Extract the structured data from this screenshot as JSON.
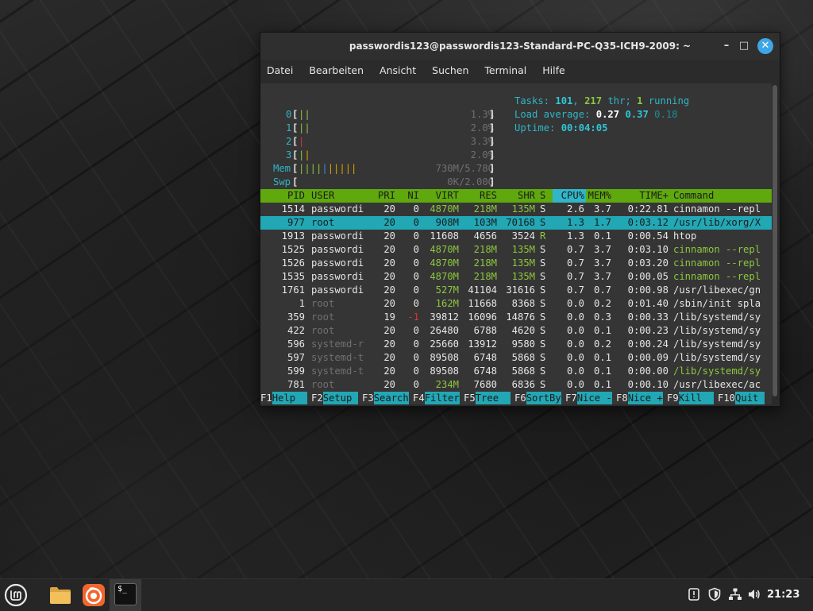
{
  "window": {
    "title": "passwordis123@passwordis123-Standard-PC-Q35-ICH9-2009: ~",
    "minimize": "–",
    "maximize": "□",
    "close": "✕"
  },
  "menu": [
    "Datei",
    "Bearbeiten",
    "Ansicht",
    "Suchen",
    "Terminal",
    "Hilfe"
  ],
  "meters": {
    "cpus": [
      {
        "label": "0",
        "value": "1.3%"
      },
      {
        "label": "1",
        "value": "2.0%"
      },
      {
        "label": "2",
        "value": "3.3%"
      },
      {
        "label": "3",
        "value": "2.0%"
      }
    ],
    "mem": {
      "label": "Mem",
      "value": "730M/5.78G"
    },
    "swp": {
      "label": "Swp",
      "value": "0K/2.00G"
    }
  },
  "summary": {
    "tasks_label": "Tasks:",
    "tasks": "101",
    "threads": "217",
    "thr_label": "thr;",
    "running": "1",
    "running_label": "running",
    "load_label": "Load average:",
    "load1": "0.27",
    "load5": "0.37",
    "load15": "0.18",
    "uptime_label": "Uptime:",
    "uptime": "00:04:05"
  },
  "table": {
    "headers": [
      "PID",
      "USER",
      "PRI",
      "NI",
      "VIRT",
      "RES",
      "SHR",
      "S",
      "CPU%",
      "MEM%",
      "TIME+",
      "Command"
    ],
    "rows": [
      [
        "1514",
        "passwordi",
        "20",
        "0",
        "4870M",
        "218M",
        "135M",
        "S",
        "2.6",
        "3.7",
        "0:22.81",
        "cinnamon --repl"
      ],
      [
        "977",
        "root",
        "20",
        "0",
        "908M",
        "103M",
        "70168",
        "S",
        "1.3",
        "1.7",
        "0:03.12",
        "/usr/lib/xorg/X"
      ],
      [
        "1913",
        "passwordi",
        "20",
        "0",
        "11608",
        "4656",
        "3524",
        "R",
        "1.3",
        "0.1",
        "0:00.54",
        "htop"
      ],
      [
        "1525",
        "passwordi",
        "20",
        "0",
        "4870M",
        "218M",
        "135M",
        "S",
        "0.7",
        "3.7",
        "0:03.10",
        "cinnamon --repl"
      ],
      [
        "1526",
        "passwordi",
        "20",
        "0",
        "4870M",
        "218M",
        "135M",
        "S",
        "0.7",
        "3.7",
        "0:03.20",
        "cinnamon --repl"
      ],
      [
        "1535",
        "passwordi",
        "20",
        "0",
        "4870M",
        "218M",
        "135M",
        "S",
        "0.7",
        "3.7",
        "0:00.05",
        "cinnamon --repl"
      ],
      [
        "1761",
        "passwordi",
        "20",
        "0",
        "527M",
        "41104",
        "31616",
        "S",
        "0.7",
        "0.7",
        "0:00.98",
        "/usr/libexec/gn"
      ],
      [
        "1",
        "root",
        "20",
        "0",
        "162M",
        "11668",
        "8368",
        "S",
        "0.0",
        "0.2",
        "0:01.40",
        "/sbin/init spla"
      ],
      [
        "359",
        "root",
        "19",
        "-1",
        "39812",
        "16096",
        "14876",
        "S",
        "0.0",
        "0.3",
        "0:00.33",
        "/lib/systemd/sy"
      ],
      [
        "422",
        "root",
        "20",
        "0",
        "26480",
        "6788",
        "4620",
        "S",
        "0.0",
        "0.1",
        "0:00.23",
        "/lib/systemd/sy"
      ],
      [
        "596",
        "systemd-r",
        "20",
        "0",
        "25660",
        "13912",
        "9580",
        "S",
        "0.0",
        "0.2",
        "0:00.24",
        "/lib/systemd/sy"
      ],
      [
        "597",
        "systemd-t",
        "20",
        "0",
        "89508",
        "6748",
        "5868",
        "S",
        "0.0",
        "0.1",
        "0:00.09",
        "/lib/systemd/sy"
      ],
      [
        "599",
        "systemd-t",
        "20",
        "0",
        "89508",
        "6748",
        "5868",
        "S",
        "0.0",
        "0.1",
        "0:00.00",
        "/lib/systemd/sy"
      ],
      [
        "781",
        "root",
        "20",
        "0",
        "234M",
        "7680",
        "6836",
        "S",
        "0.0",
        "0.1",
        "0:00.10",
        "/usr/libexec/ac"
      ]
    ]
  },
  "fkeys": [
    {
      "key": "F1",
      "label": "Help  "
    },
    {
      "key": "F2",
      "label": "Setup "
    },
    {
      "key": "F3",
      "label": "Search"
    },
    {
      "key": "F4",
      "label": "Filter"
    },
    {
      "key": "F5",
      "label": "Tree  "
    },
    {
      "key": "F6",
      "label": "SortBy"
    },
    {
      "key": "F7",
      "label": "Nice -"
    },
    {
      "key": "F8",
      "label": "Nice +"
    },
    {
      "key": "F9",
      "label": "Kill  "
    },
    {
      "key": "F10",
      "label": "Quit "
    }
  ],
  "taskbar": {
    "clock": "21:23",
    "terminal_glyph": "$_"
  },
  "colors": {
    "htop_header_green": "#5fa80e",
    "htop_selected_cyan": "#22a7b5",
    "close_button_blue": "#3ea6e5",
    "firefox_orange": "#f2662e",
    "folder_yellow": "#f2c05b"
  }
}
